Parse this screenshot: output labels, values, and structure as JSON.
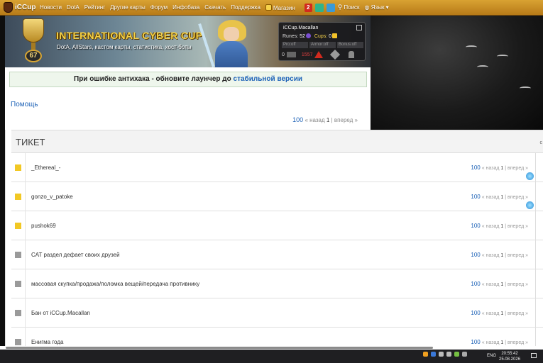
{
  "nav": {
    "logo": "iCCup",
    "items": [
      "Новости",
      "DotA",
      "Рейтинг",
      "Другие карты",
      "Форум",
      "Инфобаза",
      "Скачать",
      "Поддержка"
    ],
    "shop": "Магазин",
    "notification_count": "2",
    "search": "Поиск",
    "language": "Язык"
  },
  "banner": {
    "title": "INTERNATIONAL CYBER CUP",
    "subtitle": "DotA, AllStars, кастом карты, статистика, хост-боты",
    "trophy_level": "67"
  },
  "profile": {
    "name": "iCCup.Macallan",
    "runes_label": "Runes:",
    "runes_value": "52",
    "cups_label": "Cups:",
    "cups_value": "0",
    "stats": [
      "Pro:off",
      "Armor:off",
      "Bonus:off"
    ],
    "gold": "0",
    "alert_count": "1557"
  },
  "notice": {
    "text": "При ошибке антихака - обновите лаунчер до ",
    "link": "стабильной версии"
  },
  "help_link": "Помощь",
  "pager": {
    "num": "100",
    "back": "« назад",
    "page": "1",
    "sep": "|",
    "forward": "вперед »"
  },
  "ticket_header": "ТИКЕТ",
  "tickets": [
    {
      "title": "_Ethereal_-",
      "status_color": "#f2c824",
      "new": true
    },
    {
      "title": "gonzo_v_patoke",
      "status_color": "#f2c824",
      "new": true
    },
    {
      "title": "pushok69",
      "status_color": "#f2c824",
      "new": false
    },
    {
      "title": "CAT раздел дефает своих друзей",
      "status_color": "#9a9a9a",
      "new": false
    },
    {
      "title": "массовая скупка/продажа/поломка вещей/передача противнику",
      "status_color": "#9a9a9a",
      "new": false
    },
    {
      "title": "Бан от iCCup.Macallan",
      "status_color": "#9a9a9a",
      "new": false
    },
    {
      "title": "Енигма года",
      "status_color": "#9a9a9a",
      "new": false
    }
  ],
  "taskbar": {
    "language": "ENG",
    "time": "20:55:42",
    "date": "25.08.2026"
  }
}
